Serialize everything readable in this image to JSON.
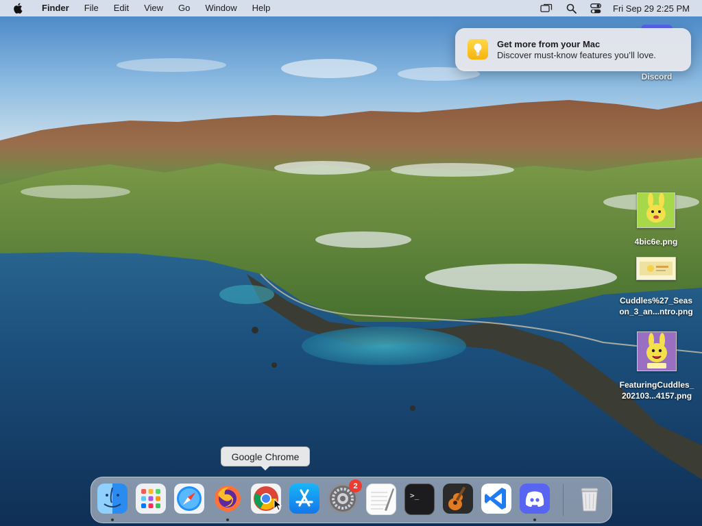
{
  "menubar": {
    "apple_icon": "apple-logo",
    "items": [
      "Finder",
      "File",
      "Edit",
      "View",
      "Go",
      "Window",
      "Help"
    ],
    "status_icons": [
      "screen-mirroring-icon",
      "search-icon",
      "control-center-icon"
    ],
    "clock": "Fri Sep 29  2:25 PM"
  },
  "notification": {
    "icon": "lightbulb-icon",
    "title": "Get more from your Mac",
    "body": "Discover must-know features you’ll love."
  },
  "desktop_icons": [
    {
      "label": "Discord"
    },
    {
      "label": "4bic6e.png"
    },
    {
      "label_line1": "Cuddles%27_Seas",
      "label_line2": "on_3_an...ntro.png"
    },
    {
      "label_line1": "FeaturingCuddles_",
      "label_line2": "202103...4157.png"
    }
  ],
  "tooltip": "Google Chrome",
  "dock": {
    "apps": [
      "Finder",
      "Launchpad",
      "Safari",
      "Firefox",
      "Google Chrome",
      "App Store",
      "System Preferences",
      "TextEdit",
      "Terminal",
      "GarageBand",
      "Visual Studio Code",
      "Discord",
      "Trash"
    ],
    "system_preferences_badge": "2",
    "running": [
      "Finder",
      "Firefox",
      "Discord"
    ]
  },
  "colors": {
    "accent_blue": "#1f7bf2",
    "badge_red": "#ec3b30",
    "discord_blurple": "#5865f2"
  }
}
